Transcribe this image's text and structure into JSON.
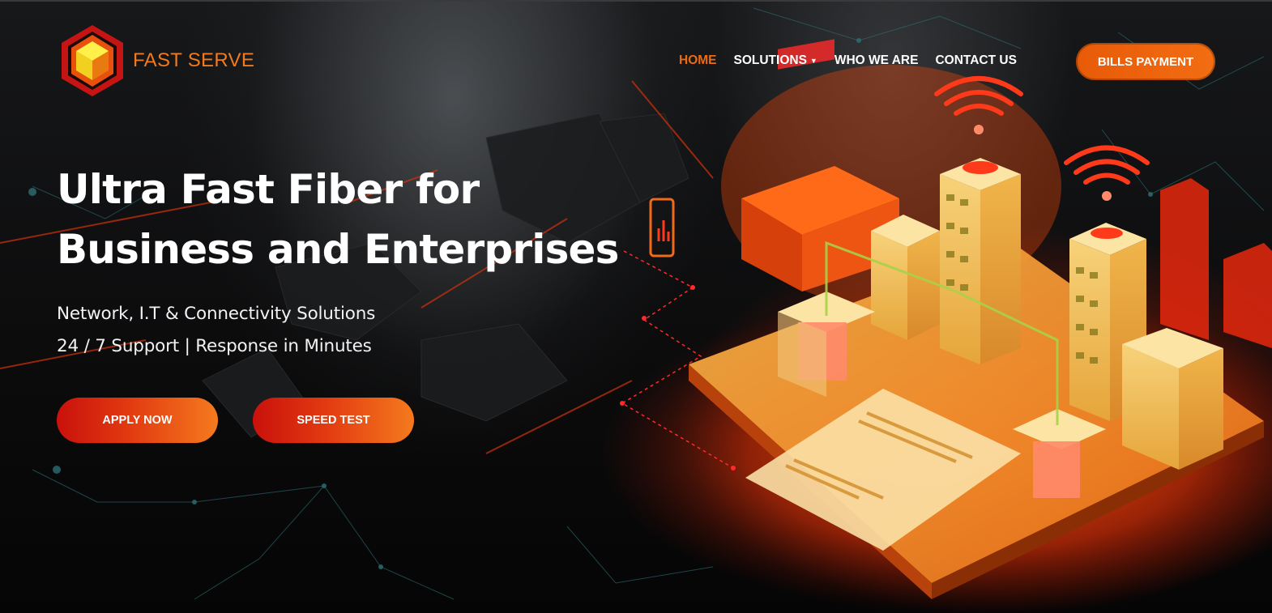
{
  "brand": {
    "name": "FAST SERVE",
    "accent": "#f07a1c"
  },
  "nav": {
    "items": [
      {
        "label": "HOME",
        "active": true
      },
      {
        "label": "SOLUTIONS",
        "has_dropdown": true
      },
      {
        "label": "WHO WE ARE"
      },
      {
        "label": "CONTACT US"
      }
    ],
    "bills_button": "BILLS PAYMENT"
  },
  "hero": {
    "headline_line1": "Ultra Fast Fiber for",
    "headline_line2": "Business and Enterprises",
    "sub_line1": "Network, I.T & Connectivity Solutions",
    "sub_line2": "24 / 7 Support | Response in Minutes",
    "apply_button": "APPLY NOW",
    "speed_button": "SPEED TEST"
  },
  "colors": {
    "primary_orange": "#ee6a12",
    "cta_red": "#c9110c",
    "background": "#0a0a0b"
  },
  "icons": {
    "logo": "hexagon-cube-icon",
    "dropdown": "caret-down-icon"
  }
}
